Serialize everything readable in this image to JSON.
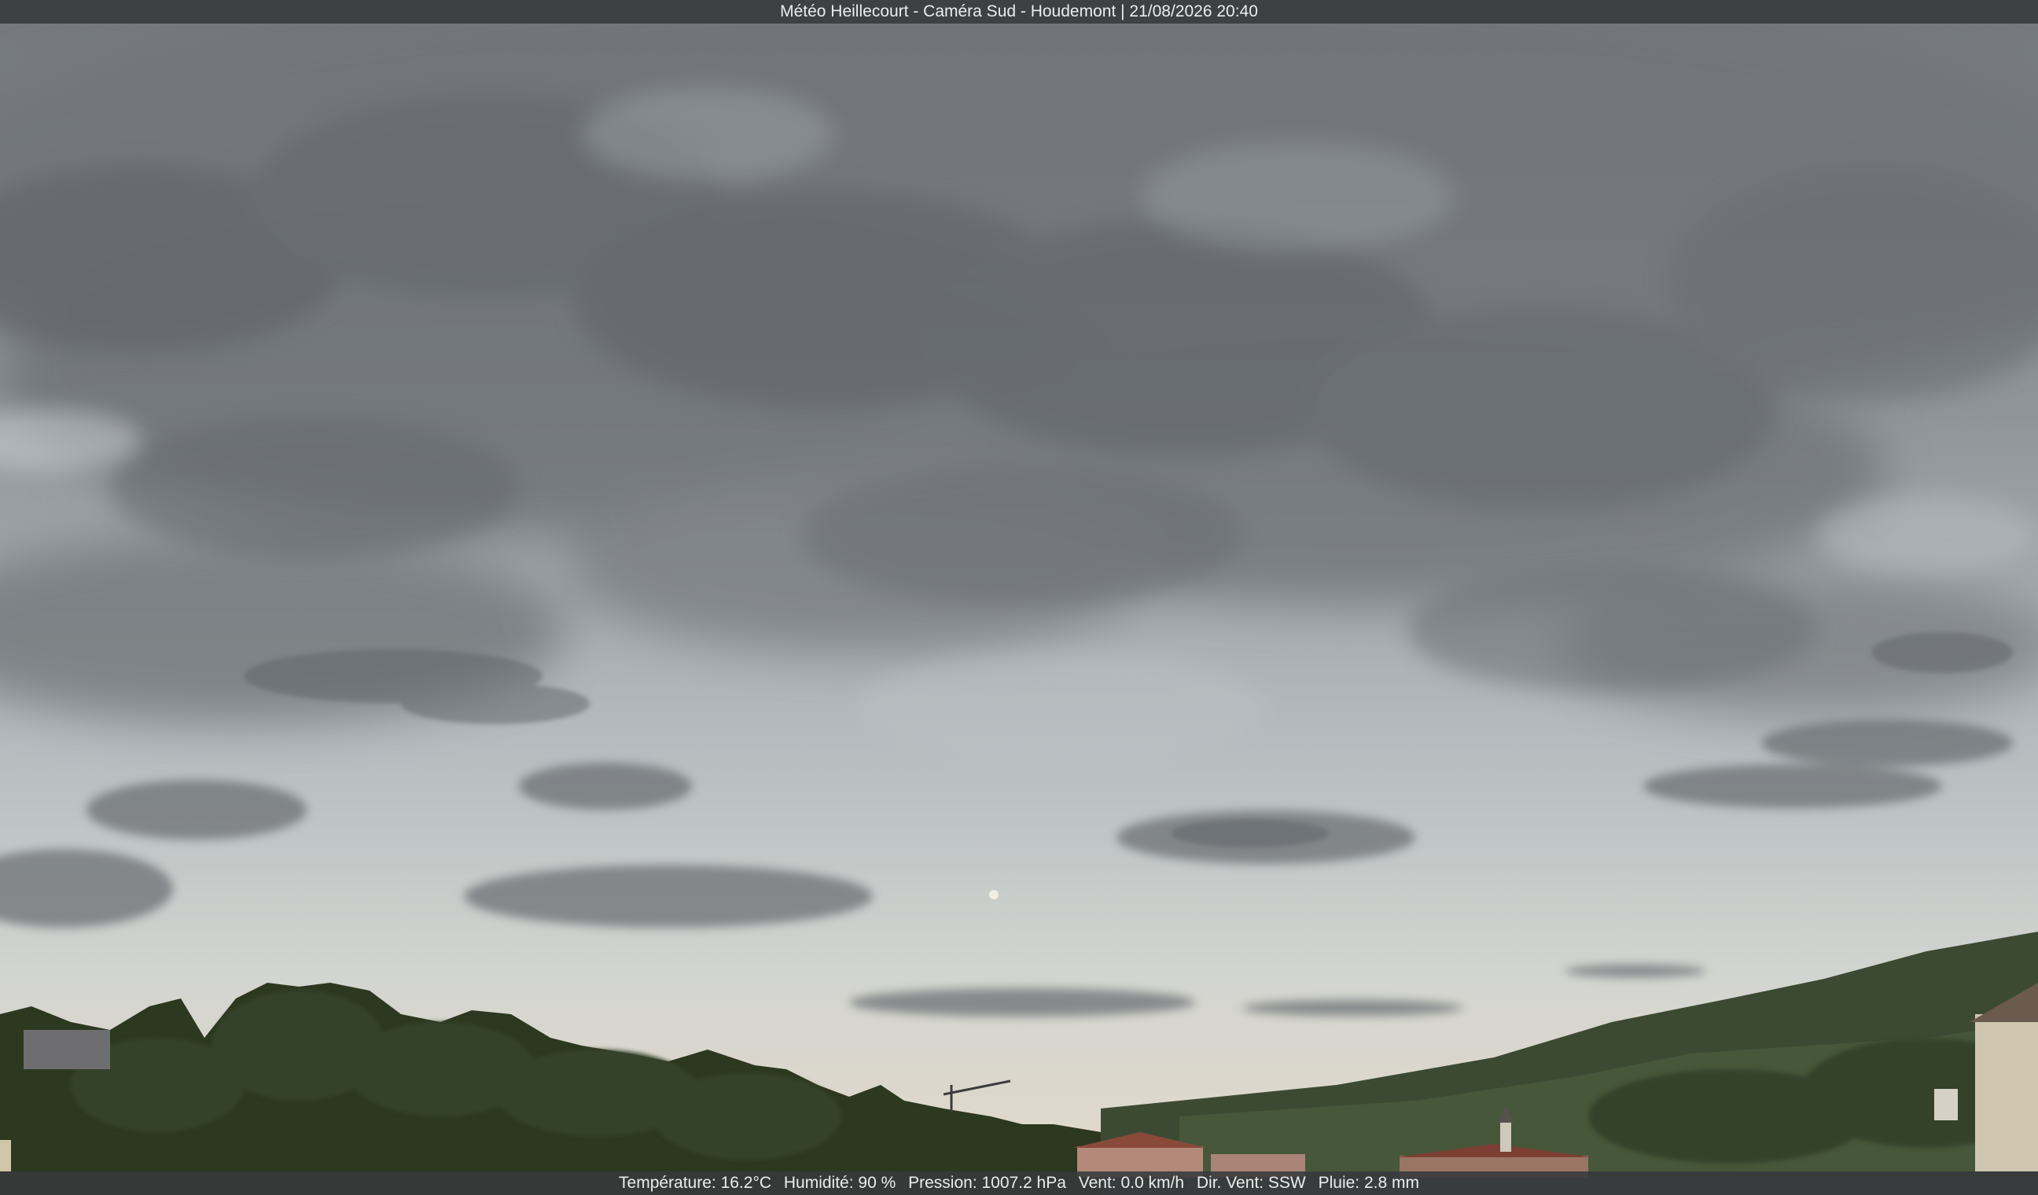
{
  "header": {
    "caption": "Météo Heillecourt - Caméra Sud - Houdemont | 21/08/2026 20:40"
  },
  "footer": {
    "temperature": "Température: 16.2°C",
    "humidity": "Humidité: 90 %",
    "pressure": "Pression: 1007.2 hPa",
    "wind": "Vent: 0.0 km/h",
    "wind_direction": "Dir. Vent: SSW",
    "rain": "Pluie: 2.8 mm"
  },
  "colors": {
    "sky_top": "#7c8085",
    "sky_mid": "#a9b1b5",
    "sky_horizon": "#d8d4c9",
    "trees": "#2d3a22",
    "bar": "#37393c"
  }
}
